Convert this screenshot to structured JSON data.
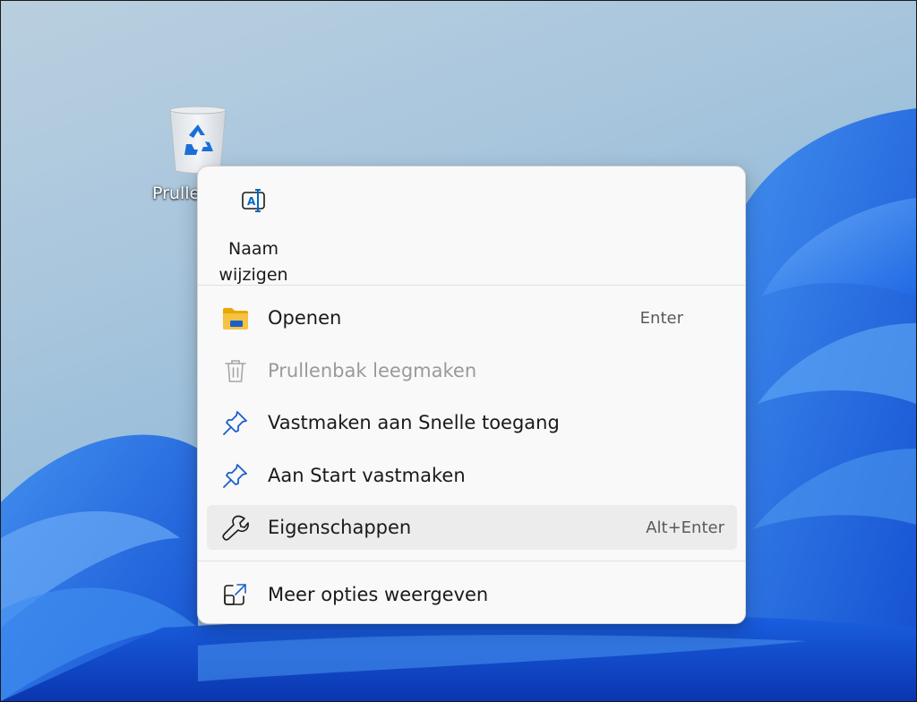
{
  "desktop": {
    "recycle_bin_label": "Prullenbak"
  },
  "context_menu": {
    "top_actions": [
      {
        "label": "Naam wijzigen",
        "icon": "rename-icon"
      }
    ],
    "items": [
      {
        "label": "Openen",
        "shortcut": "Enter",
        "icon": "folder-icon",
        "enabled": true
      },
      {
        "label": "Prullenbak leegmaken",
        "shortcut": "",
        "icon": "trash-icon",
        "enabled": false
      },
      {
        "label": "Vastmaken aan Snelle toegang",
        "shortcut": "",
        "icon": "pin-icon",
        "enabled": true
      },
      {
        "label": "Aan Start vastmaken",
        "shortcut": "",
        "icon": "pin-icon",
        "enabled": true
      },
      {
        "label": "Eigenschappen",
        "shortcut": "Alt+Enter",
        "icon": "wrench-icon",
        "enabled": true,
        "highlighted": true
      }
    ],
    "more_options": {
      "label": "Meer opties weergeven",
      "icon": "open-external-icon"
    }
  },
  "colors": {
    "accent": "#0067c0",
    "folder_yellow": "#f5c242",
    "wallpaper_blue": "#1f66e5",
    "menu_background": "#f9f9f9",
    "hover_background": "#ececec",
    "disabled_text": "#9a9a9a"
  }
}
